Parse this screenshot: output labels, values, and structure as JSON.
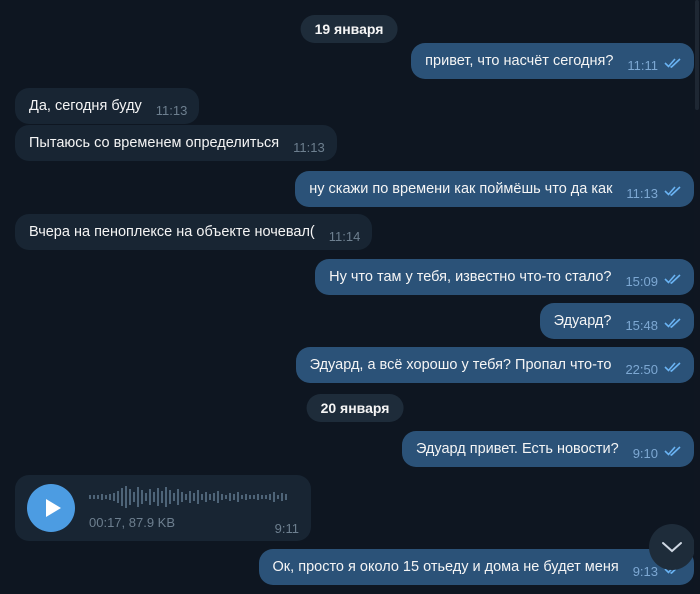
{
  "dates": [
    "19 января",
    "20 января"
  ],
  "messages": [
    {
      "dir": "out",
      "text": "привет, что насчёт сегодня?",
      "time": "11:11"
    },
    {
      "dir": "in",
      "text": "Да, сегодня буду",
      "time": "11:13"
    },
    {
      "dir": "in",
      "text": "Пытаюсь со временем определиться",
      "time": "11:13"
    },
    {
      "dir": "out",
      "text": "ну скажи по времени как поймёшь что да как",
      "time": "11:13"
    },
    {
      "dir": "in",
      "text": "Вчера на пеноплексе на объекте ночевал(",
      "time": "11:14"
    },
    {
      "dir": "out",
      "text": "Ну что там у тебя, известно что-то стало?",
      "time": "15:09"
    },
    {
      "dir": "out",
      "text": "Эдуард?",
      "time": "15:48"
    },
    {
      "dir": "out",
      "text": "Эдуард, а всё хорошо у тебя? Пропал что-то",
      "time": "22:50"
    },
    {
      "dir": "out",
      "text": "Эдуард привет. Есть новости?",
      "time": "9:10"
    },
    {
      "dir": "out",
      "text": "Ок, просто я около 15 отьеду и дома не будет меня",
      "time": "9:13"
    }
  ],
  "voice": {
    "meta": "00:17, 87.9 KB",
    "time": "9:11"
  },
  "icons": {
    "read": "double-check-icon",
    "play": "play-icon",
    "scroll": "chevron-down-icon"
  },
  "colors": {
    "background": "#0e1621",
    "incoming": "#182533",
    "outgoing": "#2b5278",
    "accent": "#4c9ce2",
    "check": "#6ab3f3"
  }
}
